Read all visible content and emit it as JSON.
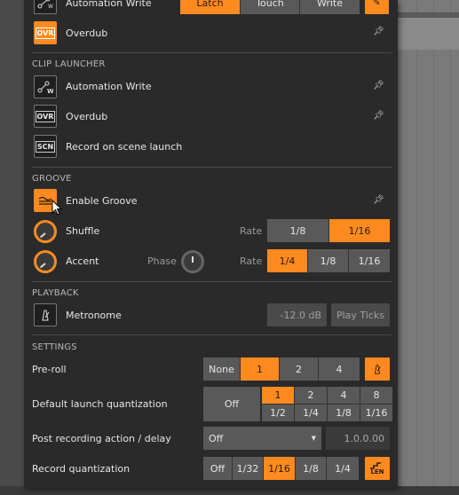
{
  "arranger": {
    "automation_write": {
      "label": "Automation Write",
      "options": [
        "Latch",
        "Touch",
        "Write"
      ],
      "selected": "Latch"
    },
    "overdub": {
      "label": "Overdub",
      "icon_text": "OVR"
    }
  },
  "clip_launcher": {
    "title": "CLIP LAUNCHER",
    "automation_write_label": "Automation Write",
    "overdub": {
      "label": "Overdub",
      "icon_text": "OVR"
    },
    "record_on_scene_launch": {
      "label": "Record on scene launch",
      "icon_text": "SCN"
    }
  },
  "groove": {
    "title": "GROOVE",
    "enable_label": "Enable Groove",
    "shuffle": {
      "label": "Shuffle",
      "rate_label": "Rate",
      "rates": [
        "1/8",
        "1/16"
      ],
      "selected": "1/16"
    },
    "accent": {
      "label": "Accent",
      "phase_label": "Phase",
      "rate_label": "Rate",
      "rates": [
        "1/4",
        "1/8",
        "1/16"
      ],
      "selected": "1/4"
    }
  },
  "playback": {
    "title": "PLAYBACK",
    "metronome_label": "Metronome",
    "volume": "-12.0 dB",
    "play_ticks_label": "Play Ticks"
  },
  "settings": {
    "title": "SETTINGS",
    "preroll": {
      "label": "Pre-roll",
      "options": [
        "None",
        "1",
        "2",
        "4"
      ],
      "selected": "1"
    },
    "launch_q": {
      "label": "Default launch quantization",
      "off_label": "Off",
      "top": [
        "1",
        "2",
        "4",
        "8"
      ],
      "bottom": [
        "1/2",
        "1/4",
        "1/8",
        "1/16"
      ],
      "selected": "1"
    },
    "post_recording": {
      "label": "Post recording action / delay",
      "action": "Off",
      "delay": "1.0.0.00"
    },
    "record_q": {
      "label": "Record quantization",
      "options": [
        "Off",
        "1/32",
        "1/16",
        "1/8",
        "1/4"
      ],
      "selected": "1/16",
      "len_icon_text": "LEN"
    }
  },
  "colors": {
    "accent": "#ff8a1f",
    "panel": "#2a2a2a",
    "button": "#595959"
  }
}
